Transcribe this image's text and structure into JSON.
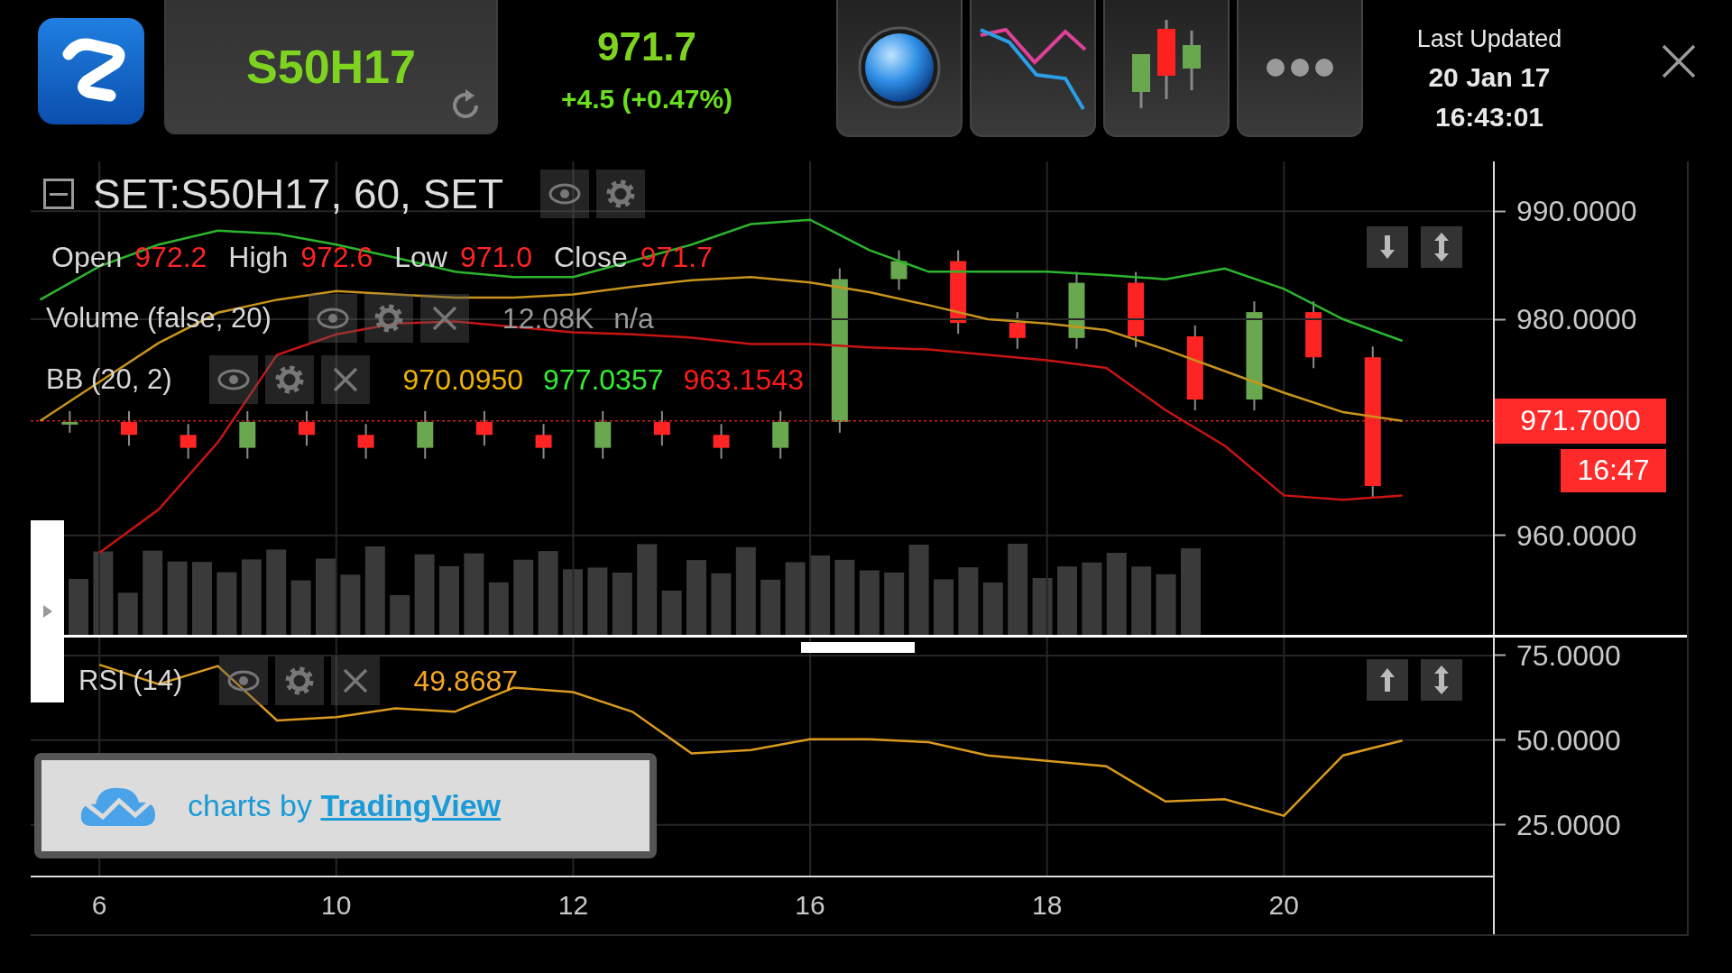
{
  "top_bar": {
    "symbol_button": "S50H17",
    "price": "971.7",
    "change": "+4.5 (+0.47%)",
    "view_buttons": [
      {
        "kind": "sphere"
      },
      {
        "kind": "line-chart"
      },
      {
        "kind": "candles"
      },
      {
        "kind": "more"
      }
    ],
    "last_updated": {
      "label": "Last Updated",
      "date": "20 Jan 17",
      "time": "16:43:01"
    }
  },
  "main_pane": {
    "symbol_legend": "SET:S50H17, 60, SET",
    "ohlc": [
      {
        "label": "Open",
        "value": "972.2"
      },
      {
        "label": "High",
        "value": "972.6"
      },
      {
        "label": "Low",
        "value": "971.0"
      },
      {
        "label": "Close",
        "value": "971.7"
      }
    ],
    "studies": [
      {
        "name": "Volume (false, 20)",
        "values": [
          {
            "text": "12.08K",
            "color": "#9a9a9a"
          },
          {
            "text": "n/a",
            "color": "#9a9a9a"
          }
        ]
      },
      {
        "name": "BB (20, 2)",
        "values": [
          {
            "text": "970.0950",
            "color": "#f0b400"
          },
          {
            "text": "977.0357",
            "color": "#33ee33"
          },
          {
            "text": "963.1543",
            "color": "#ff1a1a"
          }
        ]
      }
    ],
    "price_tag": "971.7000",
    "time_tag": "16:47",
    "chart_data": {
      "type": "line",
      "categories": [
        null,
        null,
        null,
        null,
        null,
        null,
        null,
        null,
        null,
        null,
        null,
        null,
        null,
        null,
        null,
        null,
        null,
        null,
        null,
        null,
        null,
        null,
        null,
        null
      ],
      "series": [
        {
          "color": "#2db52d",
          "values": [
            981.8,
            984.9,
            986.9,
            988.2,
            987.9,
            986.9,
            985.7,
            984.4,
            983.9,
            983.9,
            985.4,
            986.9,
            988.8,
            989.2,
            986.4,
            984.4,
            984.4,
            984.4,
            984.1,
            983.7,
            984.7,
            982.8,
            980.0,
            978.0
          ]
        },
        {
          "color": "#c8941c",
          "values": [
            970.6,
            974.2,
            977.8,
            980.6,
            981.8,
            982.6,
            982.3,
            982.0,
            982.0,
            982.3,
            983.0,
            983.6,
            983.9,
            983.4,
            982.5,
            981.3,
            980.0,
            979.6,
            979.0,
            977.2,
            975.2,
            973.2,
            971.4,
            970.6
          ]
        },
        {
          "color": "#c81414",
          "values": [
            null,
            958.4,
            962.4,
            968.6,
            976.7,
            978.6,
            979.6,
            979.8,
            979.3,
            978.8,
            978.6,
            978.3,
            977.7,
            977.7,
            977.4,
            977.2,
            976.7,
            976.2,
            975.5,
            971.6,
            968.3,
            963.7,
            963.3,
            963.7
          ]
        }
      ],
      "ylim": [
        950.8,
        994.6
      ],
      "grid": true,
      "yticks": [
        {
          "value": 990,
          "label": "990.0000"
        },
        {
          "value": 980,
          "label": "980.0000"
        },
        {
          "value": 960,
          "label": "960.0000"
        }
      ]
    }
  },
  "rsi_pane": {
    "legend": "RSI (14)",
    "value": "49.8687",
    "attribution": "charts by **TradingView**",
    "chart_data": {
      "type": "line",
      "categories": [
        null,
        "6",
        null,
        null,
        null,
        "10",
        null,
        null,
        null,
        "12",
        null,
        null,
        null,
        "16",
        null,
        null,
        null,
        "18",
        null,
        null,
        null,
        "20",
        null,
        null
      ],
      "series": [
        {
          "color": "#d99a1e",
          "values": [
            null,
            72.3,
            66.5,
            71.9,
            55.8,
            56.8,
            59.4,
            58.4,
            65.5,
            64.2,
            58.4,
            46.1,
            47.1,
            50.3,
            50.3,
            49.4,
            45.5,
            43.9,
            42.3,
            31.9,
            32.6,
            27.7,
            45.5,
            49.9
          ]
        }
      ],
      "ylim": [
        9.5,
        80.3
      ],
      "grid": true,
      "yticks": [
        {
          "value": 75,
          "label": "75.0000"
        },
        {
          "value": 50,
          "label": "50.0000"
        },
        {
          "value": 25,
          "label": "25.0000"
        }
      ]
    }
  }
}
